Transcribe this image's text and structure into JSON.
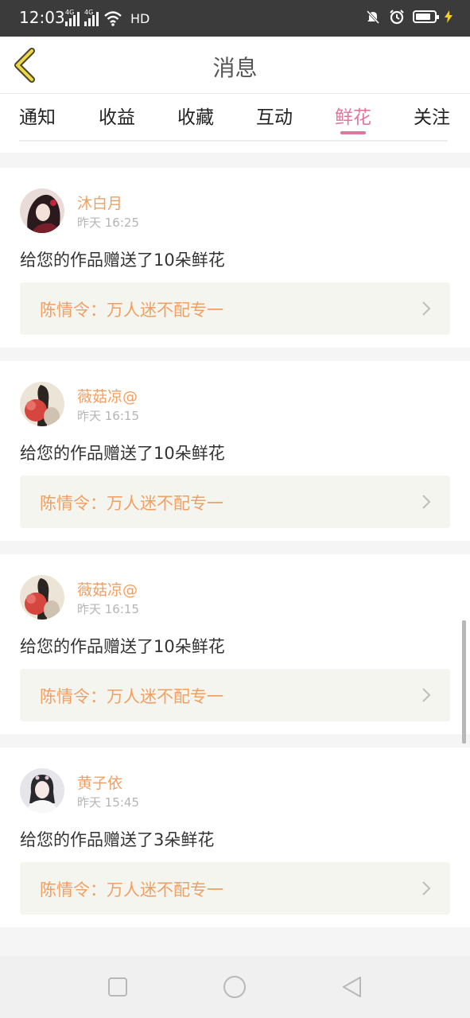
{
  "status_bar": {
    "time": "12:03",
    "network_label": "4G",
    "network_label_2": "4G",
    "hd_label": "HD",
    "icons": [
      "signal-icon",
      "signal-icon",
      "wifi-icon",
      "mute-bell-icon",
      "alarm-icon",
      "battery-icon",
      "charging-icon"
    ]
  },
  "header": {
    "title": "消息",
    "back_icon": "chevron-left-icon"
  },
  "tabs": [
    {
      "label": "通知",
      "active": false
    },
    {
      "label": "收益",
      "active": false
    },
    {
      "label": "收藏",
      "active": false
    },
    {
      "label": "互动",
      "active": false
    },
    {
      "label": "鲜花",
      "active": true
    },
    {
      "label": "关注",
      "active": false
    }
  ],
  "notifications": [
    {
      "user": "沐白月",
      "time": "昨天 16:25",
      "message": "给您的作品赠送了10朵鲜花",
      "work": "陈情令：万人迷不配专一"
    },
    {
      "user": "薇菇凉@",
      "time": "昨天 16:15",
      "message": "给您的作品赠送了10朵鲜花",
      "work": "陈情令：万人迷不配专一"
    },
    {
      "user": "薇菇凉@",
      "time": "昨天 16:15",
      "message": "给您的作品赠送了10朵鲜花",
      "work": "陈情令：万人迷不配专一"
    },
    {
      "user": "黄子依",
      "time": "昨天 15:45",
      "message": "给您的作品赠送了3朵鲜花",
      "work": "陈情令：万人迷不配专一"
    }
  ],
  "nav_bar": {
    "icons": [
      "recent-apps-icon",
      "home-icon",
      "back-icon"
    ]
  },
  "colors": {
    "accent": "#e2759e",
    "username": "#f0a064",
    "work_bg": "#f5f5ef",
    "status_bar_bg": "#3b3b3b"
  }
}
